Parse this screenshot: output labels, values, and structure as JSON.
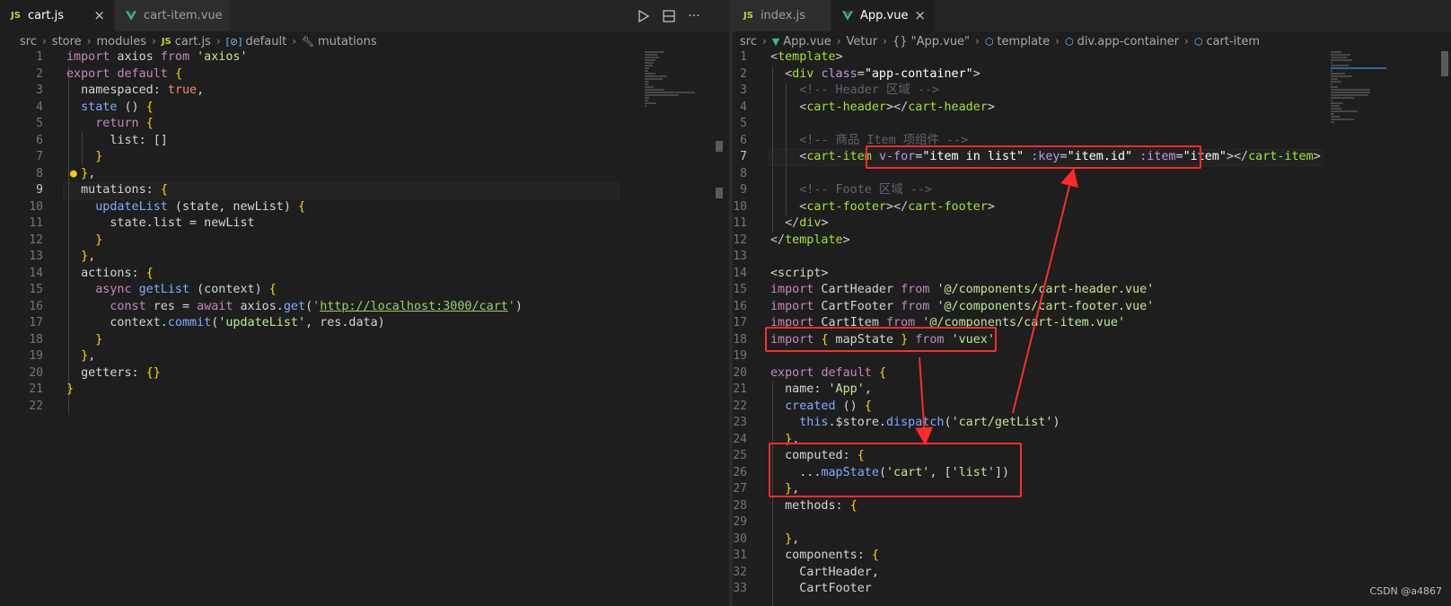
{
  "left": {
    "tabs": [
      {
        "icon": "JS",
        "label": "cart.js",
        "active": true,
        "close": "×"
      },
      {
        "icon": "vue",
        "label": "cart-item.vue",
        "active": false
      }
    ],
    "breadcrumb": [
      "src",
      "store",
      "modules",
      "cart.js",
      "default",
      "mutations"
    ],
    "code_lines": [
      "import axios from 'axios'",
      "export default {",
      "  namespaced: true,",
      "  state () {",
      "    return {",
      "      list: []",
      "    }",
      "  },",
      "  mutations: {",
      "    updateList (state, newList) {",
      "      state.list = newList",
      "    }",
      "  },",
      "  actions: {",
      "    async getList (context) {",
      "      const res = await axios.get('http://localhost:3000/cart')",
      "      context.commit('updateList', res.data)",
      "    }",
      "  },",
      "  getters: {}",
      "}",
      ""
    ],
    "current_line": 9,
    "url": "http://localhost:3000/cart"
  },
  "right": {
    "tabs": [
      {
        "icon": "JS",
        "label": "index.js",
        "active": false
      },
      {
        "icon": "vue",
        "label": "App.vue",
        "active": true,
        "close": "×"
      }
    ],
    "breadcrumb": [
      "src",
      "App.vue",
      "Vetur",
      "{} \"App.vue\"",
      "template",
      "div.app-container",
      "cart-item"
    ],
    "code_lines": [
      "<template>",
      "  <div class=\"app-container\">",
      "    <!-- Header 区域 -->",
      "    <cart-header></cart-header>",
      "",
      "    <!-- 商品 Item 项组件 -->",
      "    <cart-item v-for=\"item in list\" :key=\"item.id\" :item=\"item\"></cart-item>",
      "",
      "    <!-- Foote 区域 -->",
      "    <cart-footer></cart-footer>",
      "  </div>",
      "</template>",
      "",
      "<script>",
      "import CartHeader from '@/components/cart-header.vue'",
      "import CartFooter from '@/components/cart-footer.vue'",
      "import CartItem from '@/components/cart-item.vue'",
      "import { mapState } from 'vuex'",
      "",
      "export default {",
      "  name: 'App',",
      "  created () {",
      "    this.$store.dispatch('cart/getList')",
      "  },",
      "  computed: {",
      "    ...mapState('cart', ['list'])",
      "  },",
      "  methods: {",
      "",
      "  },",
      "  components: {",
      "    CartHeader,",
      "    CartFooter"
    ],
    "current_line": 7
  },
  "watermark": "CSDN @a4867",
  "colors": {
    "background": "#1e1e1e",
    "annotation_red": "#ff2b2b",
    "keyword": "#c586c0",
    "string": "#c3e88d",
    "tag": "#a6e22e"
  },
  "icons": {
    "run": "play-icon",
    "split": "split-editor-icon",
    "more": "more-actions-icon"
  }
}
